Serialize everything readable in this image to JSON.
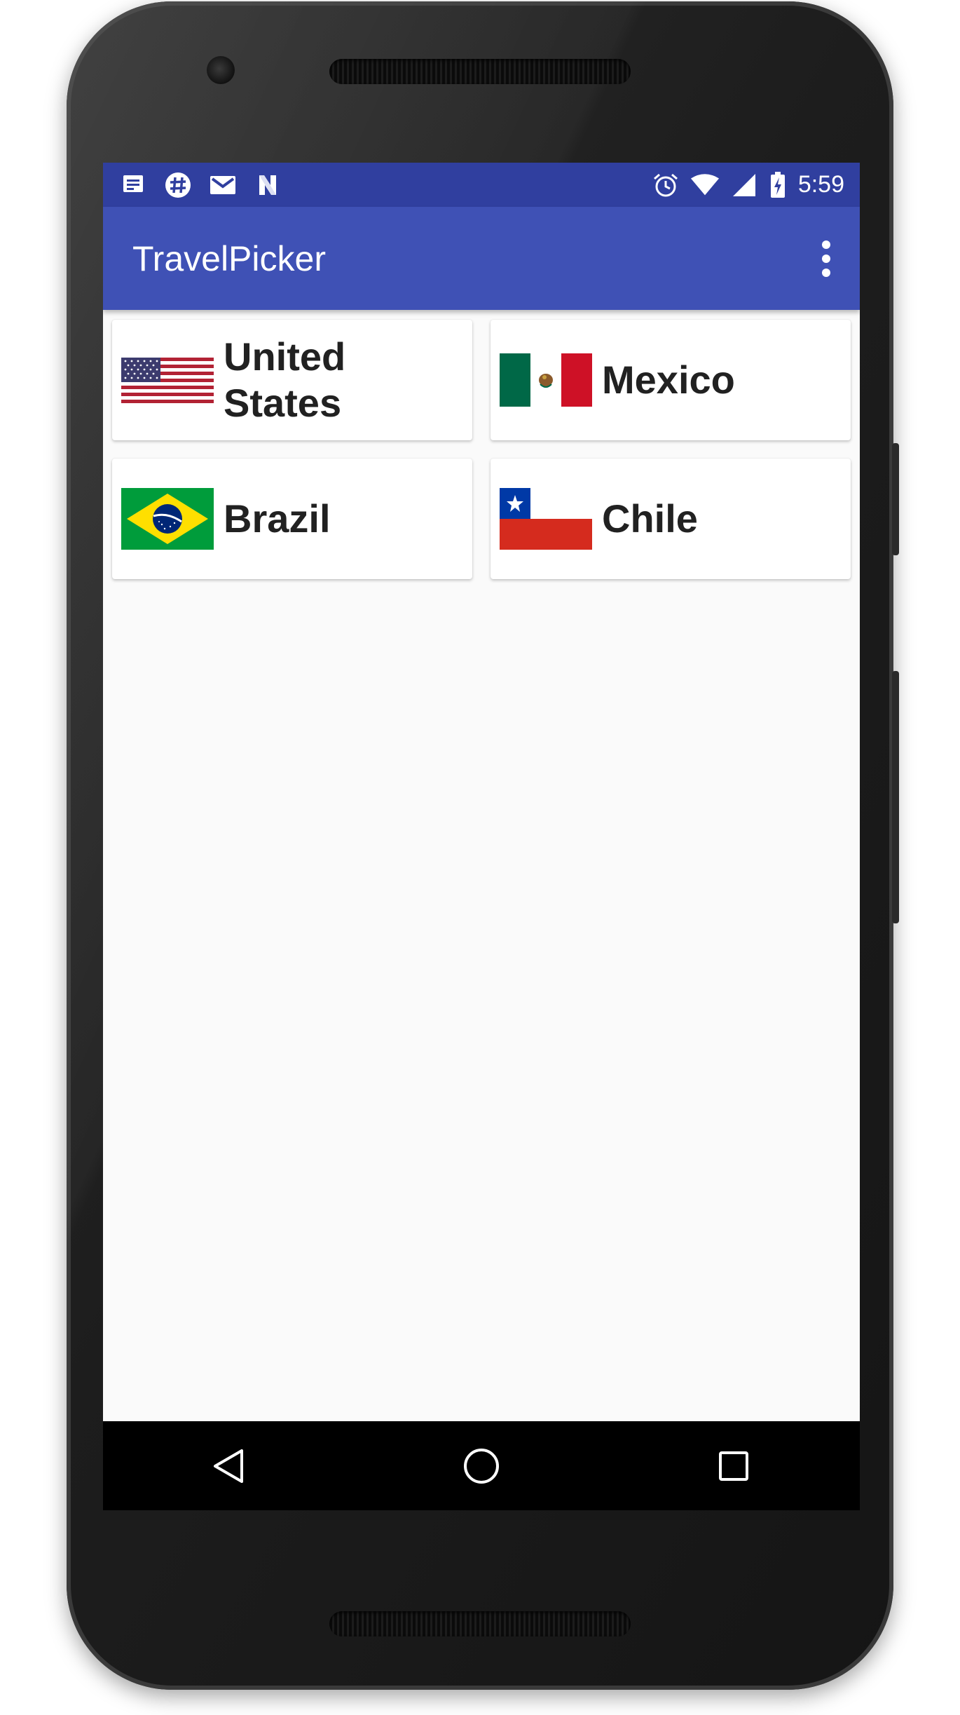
{
  "status_bar": {
    "time": "5:59",
    "left_icons": [
      "notes-icon",
      "slack-icon",
      "gmail-icon",
      "n-icon"
    ],
    "right_icons": [
      "alarm-icon",
      "wifi-icon",
      "signal-icon",
      "battery-charging-icon"
    ]
  },
  "app_bar": {
    "title": "TravelPicker",
    "menu_icon": "overflow-menu-icon"
  },
  "countries": [
    {
      "name": "United States",
      "flag": "usa-flag-icon"
    },
    {
      "name": "Mexico",
      "flag": "mexico-flag-icon"
    },
    {
      "name": "Brazil",
      "flag": "brazil-flag-icon"
    },
    {
      "name": "Chile",
      "flag": "chile-flag-icon"
    }
  ],
  "nav_bar": {
    "buttons": [
      "back-icon",
      "home-icon",
      "recents-icon"
    ]
  },
  "colors": {
    "primary": "#3f51b5",
    "primary_dark": "#303f9f",
    "background": "#fafafa"
  }
}
